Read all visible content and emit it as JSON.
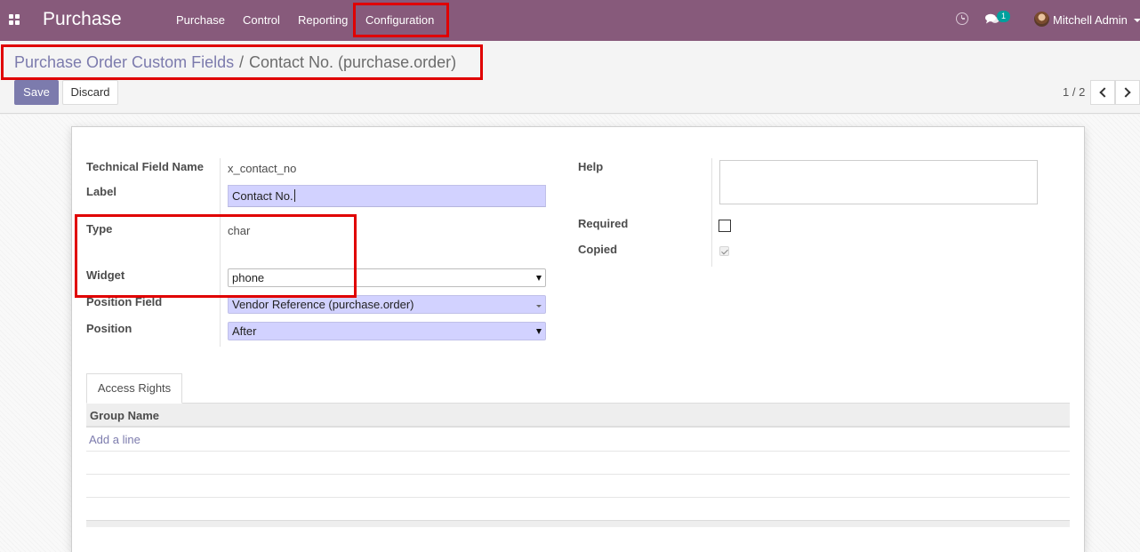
{
  "navbar": {
    "app_title": "Purchase",
    "menu": [
      "Purchase",
      "Control",
      "Reporting",
      "Configuration"
    ],
    "message_count": "1",
    "user_name": "Mitchell Admin",
    "icons": [
      "apps-grid-icon",
      "clock-icon",
      "chat-icon",
      "user-avatar",
      "caret-down-icon"
    ],
    "background": "#875a7b"
  },
  "breadcrumb": {
    "parent": "Purchase Order Custom Fields",
    "separator": "/",
    "current": "Contact No. (purchase.order)"
  },
  "buttons": {
    "save": "Save",
    "discard": "Discard"
  },
  "pager": {
    "value": "1 / 2"
  },
  "form": {
    "technical_field_name": {
      "label": "Technical Field Name",
      "value": "x_contact_no"
    },
    "field_label": {
      "label": "Label",
      "value": "Contact No."
    },
    "type": {
      "label": "Type",
      "value": "char"
    },
    "widget": {
      "label": "Widget",
      "value": "phone"
    },
    "position_field": {
      "label": "Position Field",
      "value": "Vendor Reference (purchase.order)"
    },
    "position": {
      "label": "Position",
      "value": "After"
    },
    "help": {
      "label": "Help",
      "value": ""
    },
    "required": {
      "label": "Required",
      "checked": false
    },
    "copied": {
      "label": "Copied",
      "checked": true
    }
  },
  "notebook": {
    "tab": "Access Rights",
    "column_header": "Group Name",
    "add_line": "Add a line"
  },
  "colors": {
    "primary": "#7c7bad",
    "required_field_bg": "#d2d2ff",
    "annotation_red": "#e00000"
  }
}
